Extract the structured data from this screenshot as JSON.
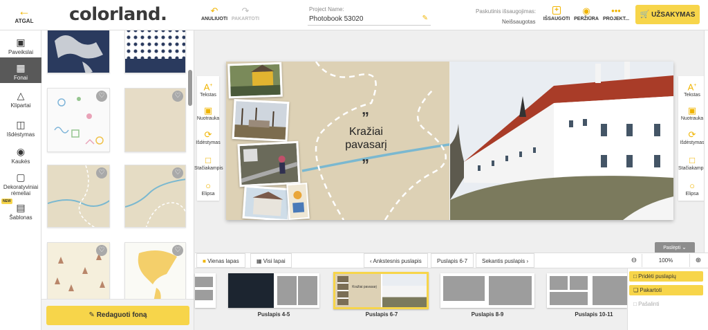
{
  "header": {
    "back_label": "ATGAL",
    "logo_text": "colorland.",
    "undo_label": "ANULIUOTI",
    "redo_label": "PAKARTOTI",
    "project_name_label": "Project Name:",
    "project_name_value": "Photobook 53020",
    "last_saved_label": "Paskutinis išsaugojimas:",
    "last_saved_value": "Neišsaugotas",
    "save_label": "IŠSAUGOTI",
    "preview_label": "PERŽIŪRA",
    "project_label": "PROJEKT...",
    "order_label": "UŽSAKYMAS"
  },
  "sidebar": {
    "items": [
      {
        "label": "Paveikslai",
        "icon": "image-icon"
      },
      {
        "label": "Fonai",
        "icon": "background-icon"
      },
      {
        "label": "Klipartai",
        "icon": "shapes-icon"
      },
      {
        "label": "Išdėstymas",
        "icon": "layout-icon"
      },
      {
        "label": "Kaukės",
        "icon": "mask-icon"
      },
      {
        "label": "Dekoratyviniai rėmeliai",
        "icon": "frame-icon"
      },
      {
        "label": "Šablonas",
        "icon": "template-icon"
      }
    ],
    "new_badge": "NEW",
    "edit_background_label": "Redaguoti foną"
  },
  "canvas": {
    "quote_open": "„",
    "quote_close": "„",
    "title_line1": "Kražiai",
    "title_line2": "pavasarį"
  },
  "tools": {
    "text_label": "Tekstas",
    "photo_label": "Nuotrauka",
    "layout_label": "Išdėstymas",
    "rect_label": "Stačiakampis",
    "ellipse_label": "Elipsa"
  },
  "hide_label": "Paslėpti",
  "bottom": {
    "single_page_label": "Vienas lapas",
    "all_pages_label": "Visi lapai",
    "prev_label": "Ankstesnis puslapis",
    "current_label": "Puslapis 6-7",
    "next_label": "Sekantis puslapis",
    "zoom_value": "100%",
    "spreads": [
      {
        "label": "Puslapis 4-5"
      },
      {
        "label": "Puslapis 6-7"
      },
      {
        "label": "Puslapis 8-9"
      },
      {
        "label": "Puslapis 10-11"
      }
    ],
    "thumb_title": "Kražiai pavasarį"
  },
  "page_menu": {
    "add_label": "Pridėti puslapių",
    "repeat_label": "Pakartoti",
    "delete_label": "Pašalinti"
  },
  "colors": {
    "accent": "#f7d54a",
    "active_nav": "#595959"
  }
}
